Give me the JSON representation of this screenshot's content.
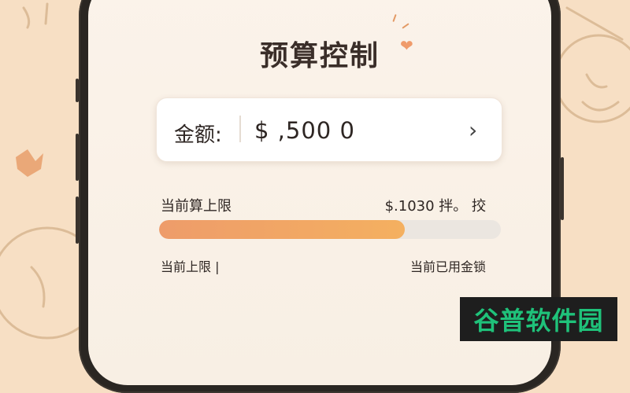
{
  "header": {
    "title": "预算控制"
  },
  "amount_card": {
    "label": "金额:",
    "value": "$ ,500 0"
  },
  "budget": {
    "limit_label": "当前算上限",
    "limit_value": "$.1030 拌。 挍",
    "progress_fraction": 0.72
  },
  "footer": {
    "left_label": "当前上限 |",
    "right_label": "当前已用金锁"
  },
  "watermark": {
    "text": "谷普软件园"
  },
  "colors": {
    "accent": "#ef9b6b",
    "progress_start": "#ee9c6a",
    "progress_end": "#f4b060",
    "watermark_green": "#1fc27a"
  }
}
